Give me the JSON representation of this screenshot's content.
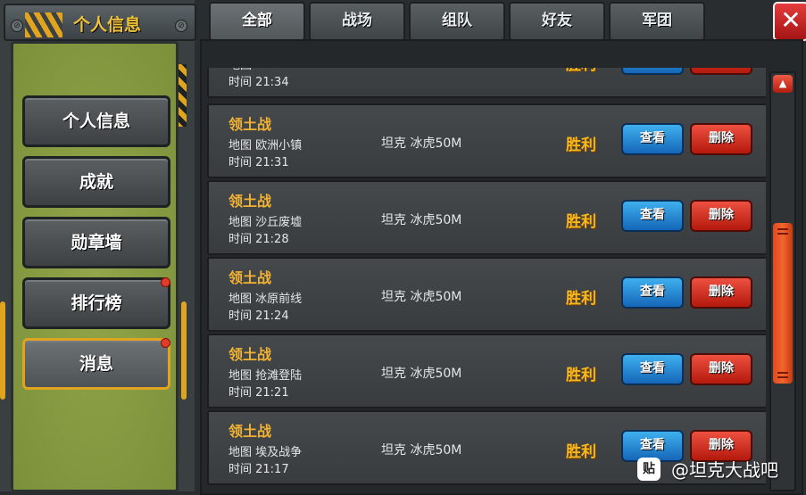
{
  "panel": {
    "title": "个人信息",
    "menu": [
      {
        "label": "个人信息",
        "dot": false,
        "active": false
      },
      {
        "label": "成就",
        "dot": false,
        "active": false
      },
      {
        "label": "勋章墙",
        "dot": false,
        "active": false
      },
      {
        "label": "排行榜",
        "dot": true,
        "active": false
      },
      {
        "label": "消息",
        "dot": true,
        "active": true
      }
    ]
  },
  "tabs": [
    {
      "label": "全部",
      "active": true
    },
    {
      "label": "战场",
      "active": false
    },
    {
      "label": "组队",
      "active": false
    },
    {
      "label": "好友",
      "active": false
    },
    {
      "label": "军团",
      "active": false
    }
  ],
  "close_label": "✕",
  "records": [
    {
      "type": "",
      "map": "地图 ",
      "time": "时间 21:34",
      "tank": "",
      "result": "胜利",
      "view_label": "",
      "delete_label": ""
    },
    {
      "type": "领土战",
      "map": "地图 欧洲小镇",
      "time": "时间 21:31",
      "tank": "坦克 冰虎50M",
      "result": "胜利",
      "view_label": "查看",
      "delete_label": "删除"
    },
    {
      "type": "领土战",
      "map": "地图 沙丘废墟",
      "time": "时间 21:28",
      "tank": "坦克 冰虎50M",
      "result": "胜利",
      "view_label": "查看",
      "delete_label": "删除"
    },
    {
      "type": "领土战",
      "map": "地图 冰原前线",
      "time": "时间 21:24",
      "tank": "坦克 冰虎50M",
      "result": "胜利",
      "view_label": "查看",
      "delete_label": "删除"
    },
    {
      "type": "领土战",
      "map": "地图 抢滩登陆",
      "time": "时间 21:21",
      "tank": "坦克 冰虎50M",
      "result": "胜利",
      "view_label": "查看",
      "delete_label": "删除"
    },
    {
      "type": "领土战",
      "map": "地图 埃及战争",
      "time": "时间 21:17",
      "tank": "坦克 冰虎50M",
      "result": "胜利",
      "view_label": "查看",
      "delete_label": "删除"
    }
  ],
  "scroll_position": 0.55,
  "watermark": {
    "icon": "贴",
    "text": "@坦克大战吧"
  },
  "colors": {
    "accent": "#e0a41e",
    "result": "#f6b91c",
    "view": "#1f7fd0",
    "delete": "#d8301e"
  }
}
